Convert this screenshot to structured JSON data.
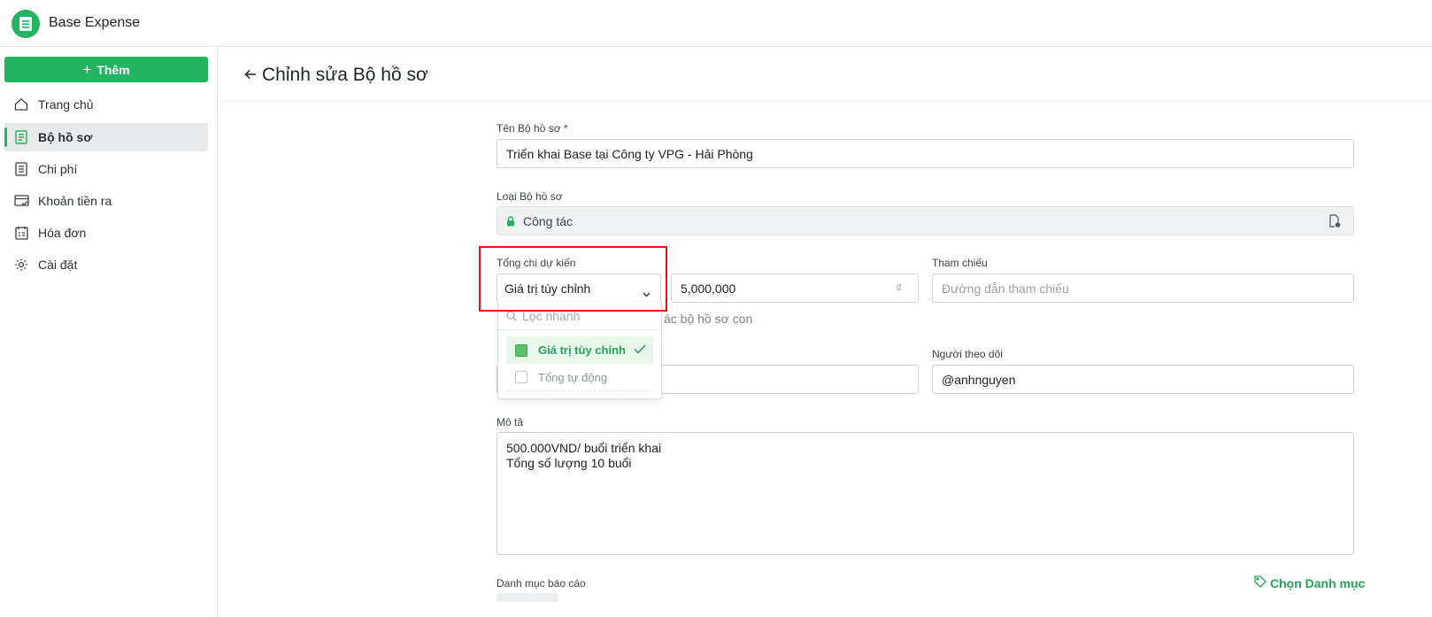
{
  "app": {
    "title": "Base Expense"
  },
  "sidebar": {
    "add_label": "Thêm",
    "items": [
      {
        "label": "Trang chủ",
        "icon": "home-icon"
      },
      {
        "label": "Bộ hồ sơ",
        "icon": "folder-doc-icon",
        "active": true
      },
      {
        "label": "Chi phí",
        "icon": "list-doc-icon"
      },
      {
        "label": "Khoản tiền ra",
        "icon": "card-icon"
      },
      {
        "label": "Hóa đơn",
        "icon": "invoice-icon"
      },
      {
        "label": "Cài đặt",
        "icon": "gear-icon"
      }
    ]
  },
  "page": {
    "title": "Chỉnh sửa Bộ hồ sơ"
  },
  "form": {
    "name_label": "Tên Bộ hồ sơ *",
    "name_value": "Triển khai Base tại Công ty VPG - Hải Phòng",
    "type_label": "Loại Bộ hồ sơ",
    "type_value": "Công tác",
    "total_label": "Tổng chi dự kiến",
    "total_mode_value": "Giá trị tùy chỉnh",
    "total_amount_value": "5,000,000",
    "currency_symbol": "₫",
    "total_hint_partial": "ác bộ hồ sơ con",
    "ref_label": "Tham chiếu",
    "ref_placeholder": "Đường dẫn tham chiếu",
    "follower_label": "Người theo dõi",
    "follower_value": "@anhnguyen",
    "desc_label": "Mô tả",
    "desc_lines": [
      "500.000VND/ buổi triển khai",
      "Tổng số lượng 10 buổi"
    ],
    "category_label": "Danh mục báo cáo",
    "choose_category": "Chọn Danh mục"
  },
  "dropdown": {
    "search_placeholder": "Lọc nhanh",
    "options": [
      {
        "label": "Giá trị tùy chỉnh",
        "selected": true
      },
      {
        "label": "Tổng tự động",
        "selected": false
      }
    ]
  },
  "colors": {
    "brand": "#23b45f",
    "highlight": "#ee1111"
  }
}
